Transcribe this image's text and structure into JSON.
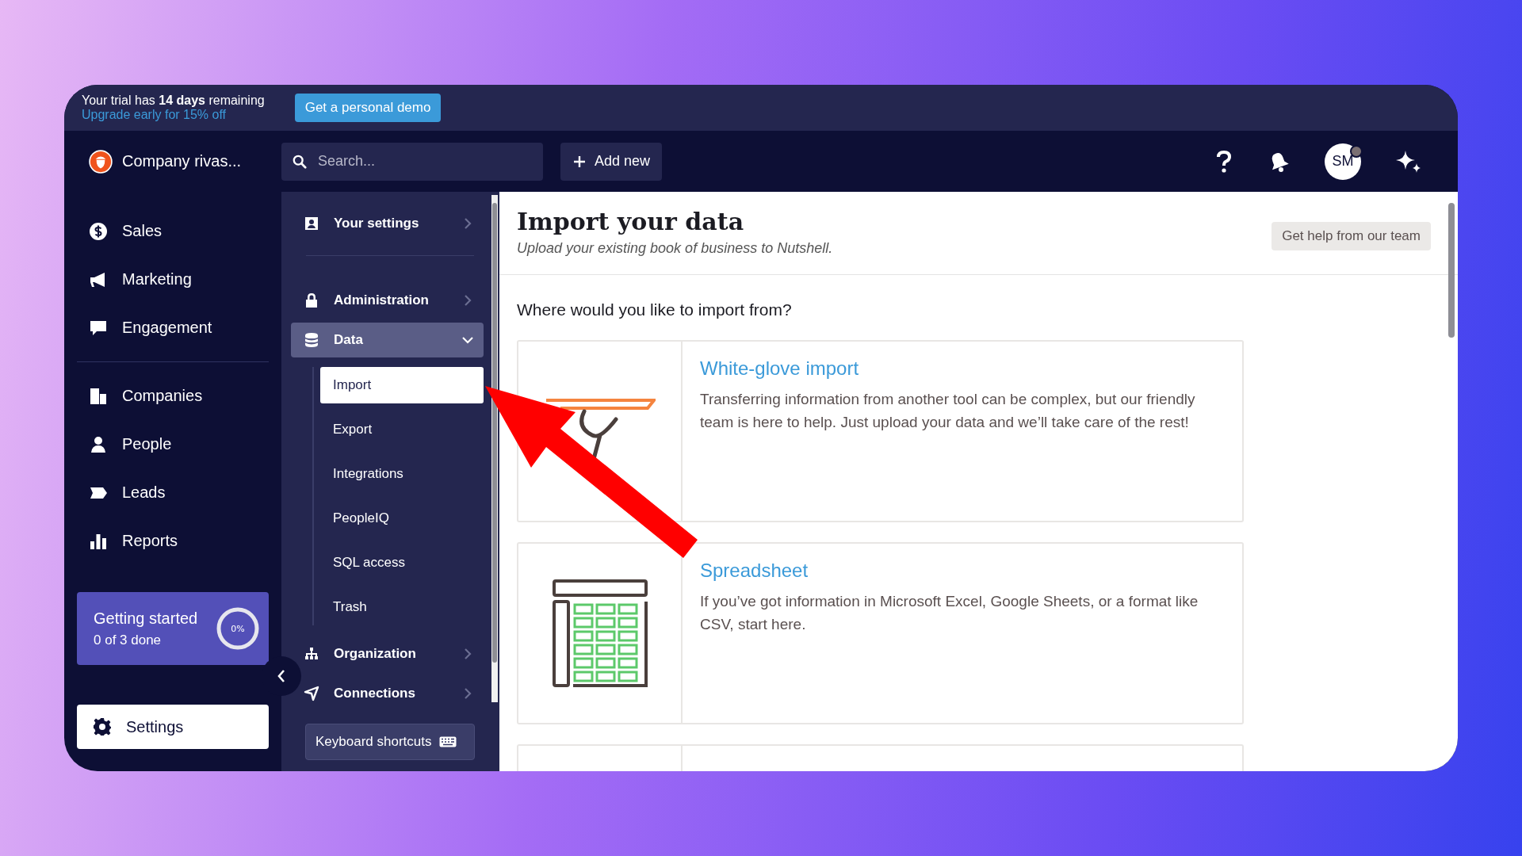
{
  "banner": {
    "trial_text": "Your trial has **14 days** remaining",
    "upgrade_link": "Upgrade early for 15% off",
    "demo_button": "Get a personal demo"
  },
  "topbar": {
    "company": "Company rivas...",
    "search": {
      "placeholder": "Search..."
    },
    "add_button": "Add new",
    "avatar": "SM"
  },
  "nav_groups": [
    [
      {
        "label": "Sales",
        "selected": false
      },
      {
        "label": "Marketing",
        "selected": false
      },
      {
        "label": "Engagement",
        "selected": false
      }
    ],
    [
      {
        "label": "Companies",
        "selected": false
      },
      {
        "label": "People",
        "selected": false
      },
      {
        "label": "Leads",
        "selected": false
      },
      {
        "label": "Reports",
        "selected": false
      }
    ]
  ],
  "getting_started": {
    "title": "Getting started",
    "progress": "0 of 3 done",
    "percent": "0%",
    "level": 0
  },
  "settings_button": {
    "label": "Settings",
    "selected": true
  },
  "settings_menu": {
    "items": [
      {
        "label": "Your settings",
        "expanded": false,
        "selected": false
      },
      {
        "label": "Administration",
        "expanded": false,
        "selected": false
      },
      {
        "label": "Data",
        "expanded": true,
        "selected": true,
        "children": [
          {
            "label": "Import",
            "selected": true
          },
          {
            "label": "Export",
            "selected": false
          },
          {
            "label": "Integrations",
            "selected": false
          },
          {
            "label": "PeopleIQ",
            "selected": false
          },
          {
            "label": "SQL access",
            "selected": false
          },
          {
            "label": "Trash",
            "selected": false
          }
        ]
      },
      {
        "label": "Organization",
        "expanded": false,
        "selected": false
      },
      {
        "label": "Connections",
        "expanded": false,
        "selected": false
      }
    ],
    "keyboard_shortcuts": "Keyboard shortcuts"
  },
  "content": {
    "title": "Import your data",
    "subtitle": "Upload your existing book of business to Nutshell.",
    "help_button": "Get help from our team",
    "question": "Where would you like to import from?",
    "options": [
      {
        "kind": "white-glove",
        "title": "White-glove import",
        "description": "Transferring information from another tool can be complex, but our friendly team is here to help. Just upload your data and we’ll take care of the rest!"
      },
      {
        "kind": "spreadsheet",
        "title": "Spreadsheet",
        "description": "If you’ve got information in Microsoft Excel, Google Sheets, or a format like CSV, start here."
      },
      {
        "kind": "hidden"
      }
    ]
  }
}
